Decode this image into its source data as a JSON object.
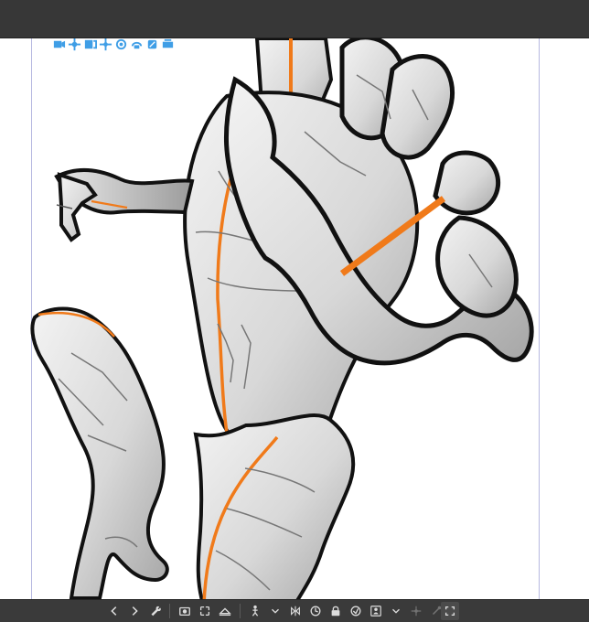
{
  "window": {
    "theme": "dark",
    "accent": "#f07a1a"
  },
  "canvas": {
    "background": "#ffffff",
    "guide_color": "#b6b8e0"
  },
  "manipulator_icons": [
    "move-camera-icon",
    "pan-icon",
    "zoom-icon",
    "move-object-icon",
    "rotate-object-icon",
    "rotate-object-y-icon",
    "scale-object-icon",
    "move-plane-icon"
  ],
  "bottom_toolbar": {
    "icons": [
      "previous-icon",
      "next-icon",
      "wrench-icon",
      "camera-icon",
      "fit-view-icon",
      "ground-icon",
      "pose-icon",
      "dropdown-icon",
      "flip-icon",
      "reset-pose-icon",
      "lock-joint-icon",
      "register-pose-icon",
      "person-frame-icon",
      "dropdown-icon-2",
      "joint-icon",
      "joint-end-icon",
      "fullscreen-icon"
    ]
  }
}
